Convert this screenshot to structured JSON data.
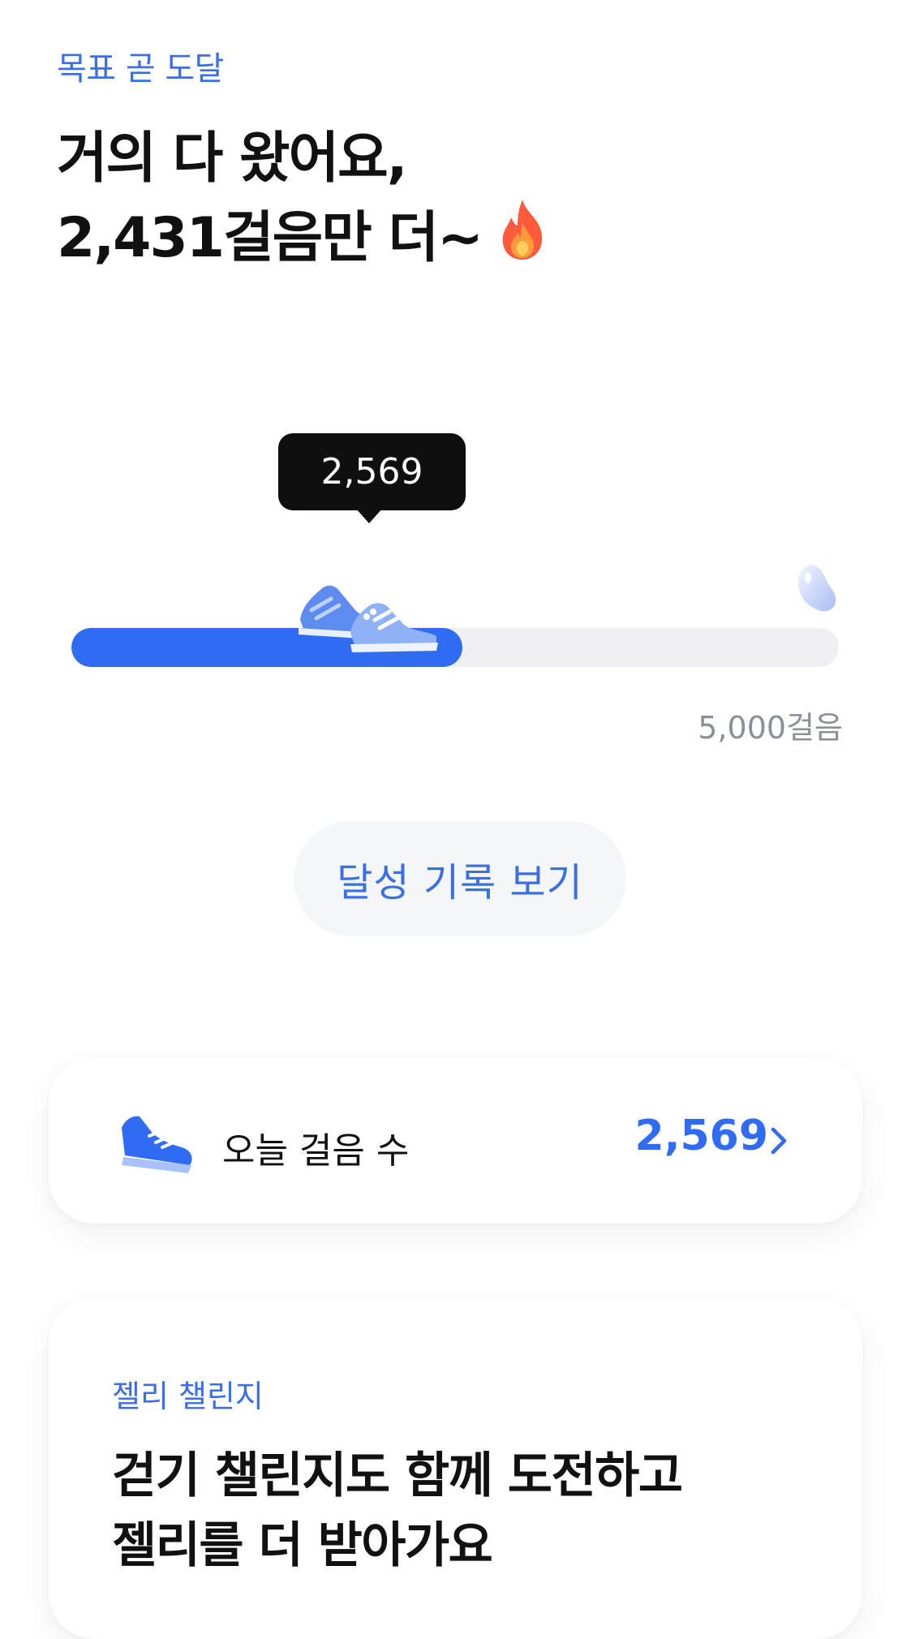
{
  "header": {
    "eyebrow": "목표 곧 도달",
    "headline_line1": "거의 다 왔어요,",
    "headline_line2": "2,431걸음만 더~",
    "headline_icon": "fire-icon"
  },
  "progress": {
    "current_steps": 2569,
    "current_label": "2,569",
    "goal_steps": 5000,
    "goal_label": "5,000걸음",
    "fill_fraction": 0.51,
    "fill_color": "#2f6cf3",
    "track_color": "#f0f0f2",
    "marker_icon": "shoes-icon",
    "goal_icon": "jelly-icon"
  },
  "history_button": {
    "label": "달성 기록 보기"
  },
  "today_card": {
    "label": "오늘 걸음 수",
    "value": "2,569",
    "icon": "sneaker-icon",
    "accent": "#2f6cf3"
  },
  "challenge_card": {
    "eyebrow": "젤리 챌린지",
    "title_line1": "걷기 챌린지도 함께 도전하고",
    "title_line2": "젤리를 더 받아가요"
  }
}
